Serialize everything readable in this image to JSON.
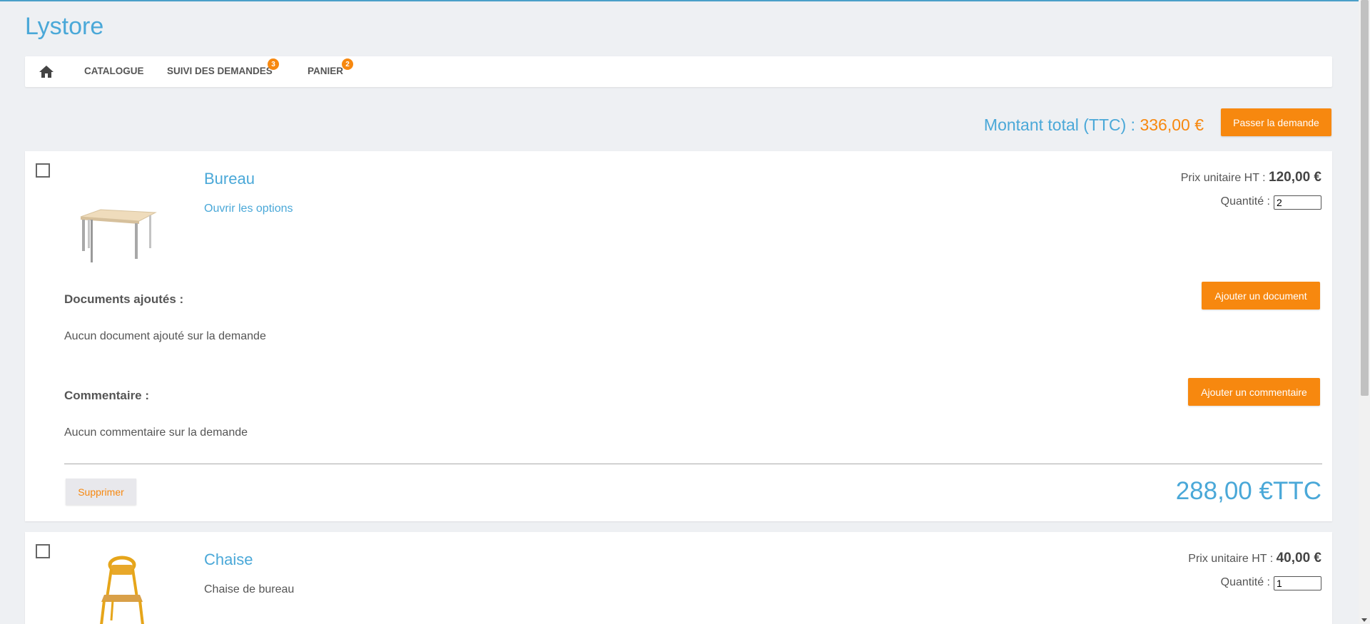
{
  "app": {
    "brand": "Lystore"
  },
  "nav": {
    "home_icon": "home-icon",
    "items": [
      {
        "label": "CATALOGUE"
      },
      {
        "label": "SUIVI DES DEMANDES",
        "badge": "3"
      },
      {
        "label": "PANIER",
        "badge": "2"
      }
    ]
  },
  "cart": {
    "total_label": "Montant total (TTC) : ",
    "total_amount": "336,00 €",
    "submit_label": "Passer la demande"
  },
  "items": [
    {
      "title": "Bureau",
      "link": "Ouvrir les options",
      "unit_price_label": "Prix unitaire HT : ",
      "unit_price": "120,00 €",
      "quantity_label": "Quantité : ",
      "quantity": "2",
      "documents_head": "Documents ajoutés :",
      "documents_text": "Aucun document ajouté sur la demande",
      "add_document_label": "Ajouter un document",
      "comment_head": "Commentaire :",
      "comment_text": "Aucun commentaire sur la demande",
      "add_comment_label": "Ajouter un commentaire",
      "delete_label": "Supprimer",
      "total": "288,00 €TTC"
    },
    {
      "title": "Chaise",
      "description": "Chaise de bureau",
      "unit_price_label": "Prix unitaire HT : ",
      "unit_price": "40,00 €",
      "quantity_label": "Quantité : ",
      "quantity": "1"
    }
  ],
  "colors": {
    "accent": "#4aa8d8",
    "orange": "#f7880f",
    "background": "#eef0f3"
  }
}
